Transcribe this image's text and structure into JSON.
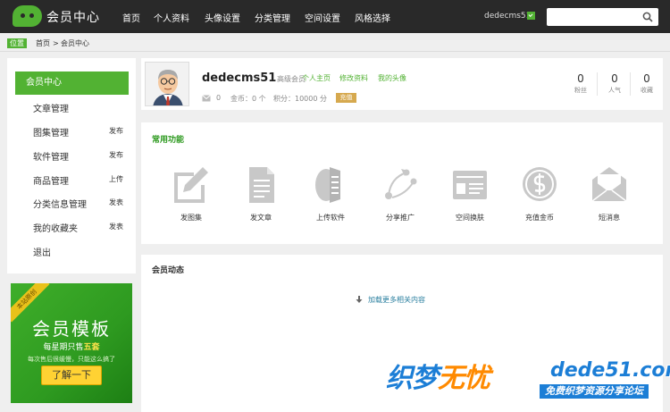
{
  "header": {
    "logo_text": "会员中心",
    "nav": [
      "首页",
      "个人资料",
      "头像设置",
      "分类管理",
      "空间设置",
      "风格选择"
    ],
    "username": "dedecms51",
    "search_placeholder": ""
  },
  "breadcrumb": {
    "tag": "位置",
    "items": [
      "首页",
      "会员中心"
    ],
    "separator": ">"
  },
  "sidebar": {
    "active": "会员中心",
    "items": [
      {
        "label": "文章管理",
        "tag": ""
      },
      {
        "label": "图集管理",
        "tag": "发布"
      },
      {
        "label": "软件管理",
        "tag": "发布"
      },
      {
        "label": "商品管理",
        "tag": "上传"
      },
      {
        "label": "分类信息管理",
        "tag": "发表"
      },
      {
        "label": "我的收藏夹",
        "tag": "发表"
      },
      {
        "label": "退出",
        "tag": ""
      }
    ]
  },
  "ad": {
    "ribbon": "本站原创",
    "title": "会员模板",
    "sub_prefix": "每星期只售",
    "sub_highlight": "五套",
    "note": "每次售后很缓慢，只能这么搞了",
    "button": "了解一下"
  },
  "profile": {
    "name": "dedecms51",
    "role": "高级会员",
    "links": [
      "个人主页",
      "修改资料",
      "我的头像"
    ],
    "mail_count": "0",
    "coins": "金币：0 个",
    "points": "积分：10000 分",
    "recharge": "充值",
    "stats": [
      {
        "value": "0",
        "label": "粉丝"
      },
      {
        "value": "0",
        "label": "人气"
      },
      {
        "value": "0",
        "label": "收藏"
      }
    ]
  },
  "functions": {
    "title": "常用功能",
    "items": [
      {
        "label": "发图集",
        "icon": "edit-icon"
      },
      {
        "label": "发文章",
        "icon": "document-icon"
      },
      {
        "label": "上传软件",
        "icon": "software-icon"
      },
      {
        "label": "分享推广",
        "icon": "share-icon"
      },
      {
        "label": "空间换肤",
        "icon": "skin-icon"
      },
      {
        "label": "充值金币",
        "icon": "coin-icon"
      },
      {
        "label": "短消息",
        "icon": "envelope-icon"
      }
    ]
  },
  "activity": {
    "title": "会员动态",
    "load_more": "加载更多相关内容"
  },
  "watermark": {
    "part1": "织梦",
    "part2": "无忧",
    "domain": "dede51.com",
    "slogan": "免费织梦资源分享论坛"
  },
  "colors": {
    "accent": "#52b233",
    "topbar": "#292929",
    "background": "#efefef",
    "recharge": "#d6a94f"
  }
}
